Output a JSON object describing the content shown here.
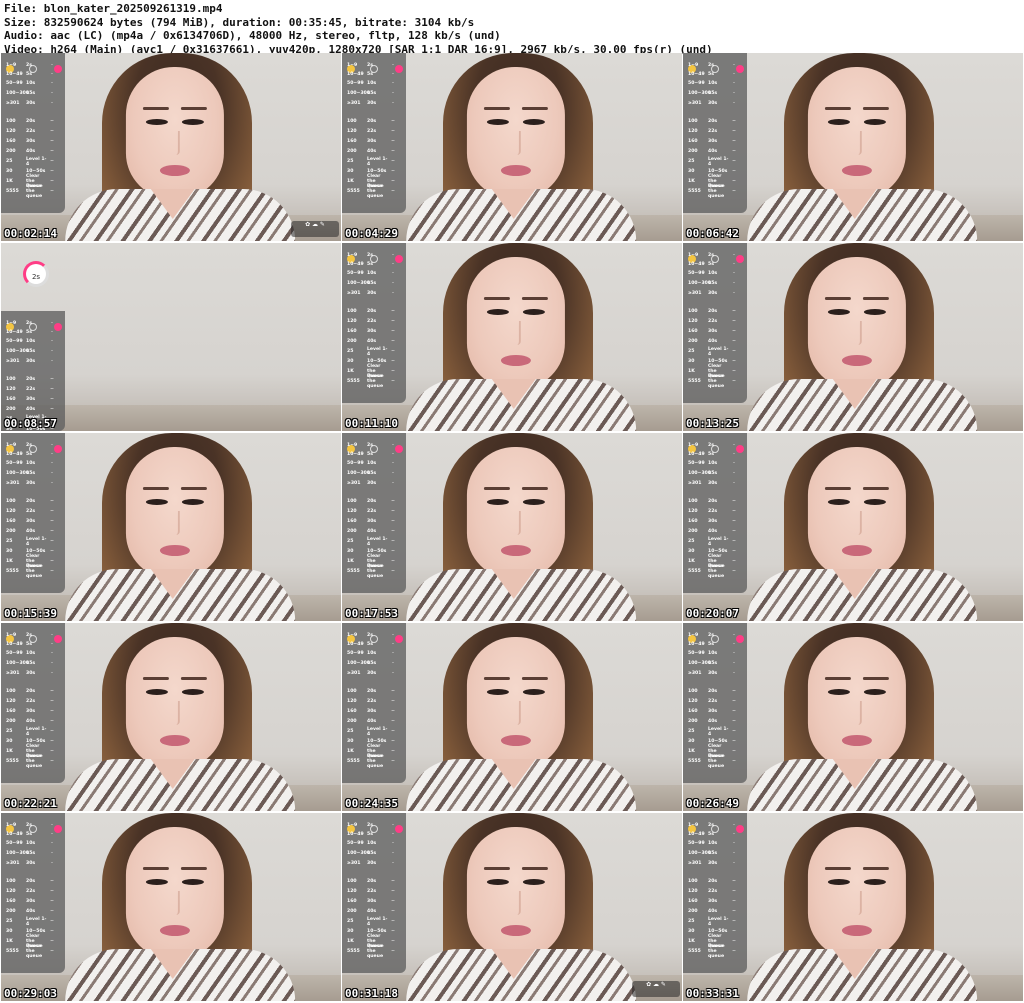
{
  "meta": {
    "line1": "File: blon_kater_202509261319.mp4",
    "line2": "Size: 832590624 bytes (794 MiB), duration: 00:35:45, bitrate: 3104 kb/s",
    "line3": "Audio: aac (LC) (mp4a / 0x6134706D), 48000 Hz, stereo, fltp, 128 kb/s (und)",
    "line4": "Video: h264 (Main) (avc1 / 0x31637661), yuv420p, 1280x720 [SAR 1:1 DAR 16:9], 2967 kb/s, 30.00 fps(r) (und)"
  },
  "timestamps": [
    "00:02:14",
    "00:04:29",
    "00:06:42",
    "00:08:57",
    "00:11:10",
    "00:13:25",
    "00:15:39",
    "00:17:53",
    "00:20:07",
    "00:22:21",
    "00:24:35",
    "00:26:49",
    "00:29:03",
    "00:31:18",
    "00:33:31"
  ],
  "panel_rows": [
    {
      "a": "1~9",
      "b": "2s"
    },
    {
      "a": "10~49",
      "b": "5s"
    },
    {
      "a": "50~99",
      "b": "10s"
    },
    {
      "a": "100~300",
      "b": "15s"
    },
    {
      "a": "≥301",
      "b": "30s"
    },
    {
      "a": "100",
      "b": "20s"
    },
    {
      "a": "120",
      "b": "22s"
    },
    {
      "a": "160",
      "b": "30s"
    },
    {
      "a": "200",
      "b": "40s"
    },
    {
      "a": "25",
      "b": "Level 1-4"
    },
    {
      "a": "30",
      "b": "10~50s"
    },
    {
      "a": "1K",
      "b": "Clear the Queue"
    },
    {
      "a": "5555",
      "b": "Pause the queue"
    }
  ],
  "colors": {
    "accent": "#ff3d86",
    "panel": "#5f5f5f"
  },
  "overlay_user": {
    "ring_text": "2s"
  }
}
